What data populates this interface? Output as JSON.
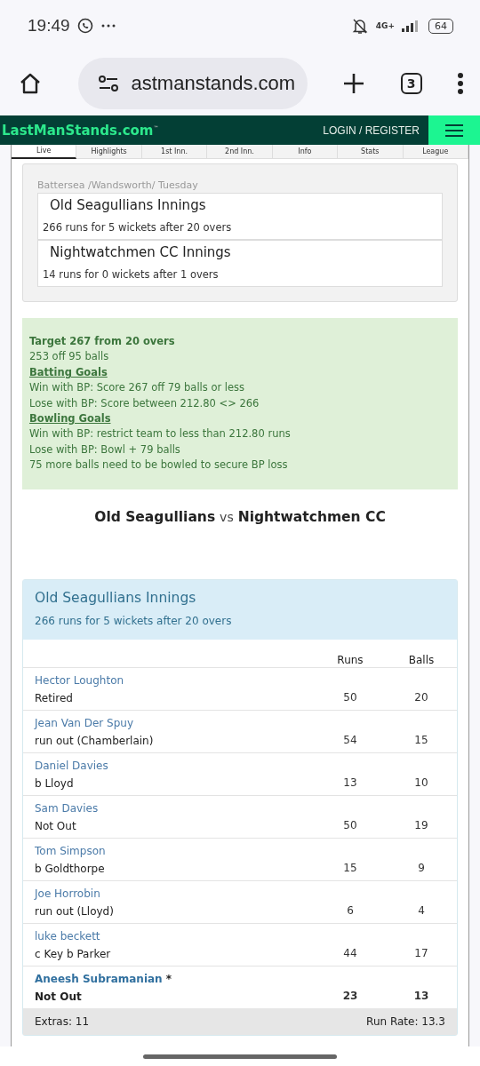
{
  "status_bar": {
    "time": "19:49",
    "network": "4G+",
    "battery": "64"
  },
  "browser": {
    "url": "astmanstands.com",
    "tab_count": "3"
  },
  "site_header": {
    "logo": "LastManStands.com",
    "trademark": "™",
    "login": "LOGIN / REGISTER"
  },
  "tabs": [
    {
      "label": "Live",
      "selected": true
    },
    {
      "label": "Highlights",
      "selected": false
    },
    {
      "label": "1st Inn.",
      "selected": false
    },
    {
      "label": "2nd Inn.",
      "selected": false
    },
    {
      "label": "Info",
      "selected": false
    },
    {
      "label": "Stats",
      "selected": false
    },
    {
      "label": "League",
      "selected": false
    }
  ],
  "summary": {
    "venue": "Battersea /Wandsworth/ Tuesday",
    "innings": [
      {
        "title": "Old Seagullians Innings",
        "score": "266 runs for 5 wickets after 20 overs"
      },
      {
        "title": "Nightwatchmen CC Innings",
        "score": "14 runs for 0 wickets after 1 overs"
      }
    ]
  },
  "goals": {
    "lines": [
      {
        "kind": "heading",
        "text": "Target 267 from 20 overs"
      },
      {
        "kind": "text",
        "text": "253 off 95 balls"
      },
      {
        "kind": "link",
        "text": "Batting Goals"
      },
      {
        "kind": "text",
        "text": "Win with BP: Score 267 off 79 balls or less"
      },
      {
        "kind": "text",
        "text": "Lose with BP: Score between 212.80 <> 266"
      },
      {
        "kind": "link",
        "text": "Bowling Goals"
      },
      {
        "kind": "text",
        "text": "Win with BP: restrict team to less than 212.80 runs"
      },
      {
        "kind": "text",
        "text": "Lose with BP: Bowl + 79 balls"
      },
      {
        "kind": "text",
        "text": "75 more balls need to be bowled to secure BP loss"
      }
    ]
  },
  "match_title": {
    "home": "Old Seagullians",
    "vs": "vs",
    "away": "Nightwatchmen CC"
  },
  "innings_panel": {
    "title": "Old Seagullians Innings",
    "score": "266 runs for 5 wickets after 20 overs",
    "columns": [
      "Runs",
      "Balls"
    ],
    "rows": [
      {
        "batter": "Hector Loughton",
        "dismissal": "Retired",
        "runs": "50",
        "balls": "20",
        "current": false
      },
      {
        "batter": "Jean Van Der Spuy",
        "dismissal": "run out (Chamberlain)",
        "runs": "54",
        "balls": "15",
        "current": false
      },
      {
        "batter": "Daniel Davies",
        "dismissal": "b Lloyd",
        "runs": "13",
        "balls": "10",
        "current": false
      },
      {
        "batter": "Sam Davies",
        "dismissal": "Not Out",
        "runs": "50",
        "balls": "19",
        "current": false
      },
      {
        "batter": "Tom Simpson",
        "dismissal": "b Goldthorpe",
        "runs": "15",
        "balls": "9",
        "current": false
      },
      {
        "batter": "Joe Horrobin",
        "dismissal": "run out (Lloyd)",
        "runs": "6",
        "balls": "4",
        "current": false
      },
      {
        "batter": "luke beckett",
        "dismissal": "c Key b Parker",
        "runs": "44",
        "balls": "17",
        "current": false
      },
      {
        "batter": "Aneesh Subramanian",
        "marker": "*",
        "dismissal": "Not Out",
        "runs": "23",
        "balls": "13",
        "current": true
      }
    ],
    "extras": "Extras: 11",
    "run_rate": "Run Rate: 13.3"
  }
}
